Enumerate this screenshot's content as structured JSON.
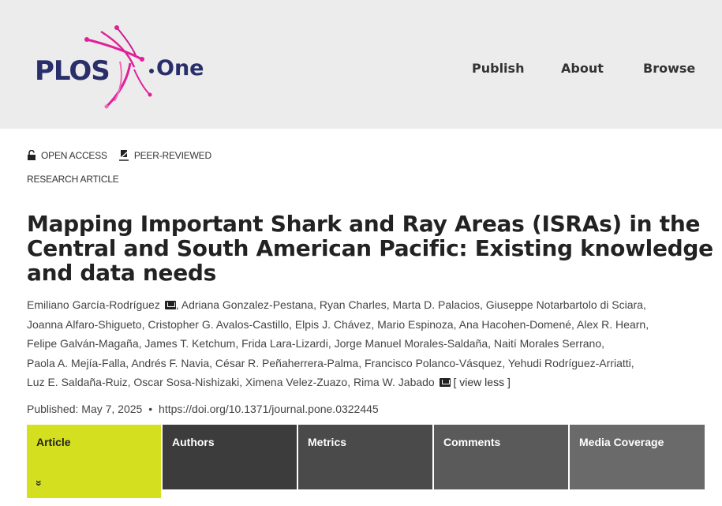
{
  "header": {
    "logo_brand": "PLOS",
    "logo_product": "One",
    "nav": [
      {
        "label": "Publish"
      },
      {
        "label": "About"
      },
      {
        "label": "Browse"
      }
    ]
  },
  "badges": {
    "open_access": "OPEN ACCESS",
    "peer_reviewed": "PEER-REVIEWED"
  },
  "article_type": "RESEARCH ARTICLE",
  "title": "Mapping Important Shark and Ray Areas (ISRAs) in the Central and South American Pacific: Existing knowledge and data needs",
  "authors": [
    "Emiliano García-Rodríguez",
    "Adriana Gonzalez-Pestana",
    "Ryan Charles",
    "Marta D. Palacios",
    "Giuseppe Notarbartolo di Sciara",
    "Joanna Alfaro-Shigueto",
    "Cristopher G. Avalos-Castillo",
    "Elpis J. Chávez",
    "Mario Espinoza",
    "Ana Hacohen-Domené",
    "Alex R. Hearn",
    "Felipe Galván-Magaña",
    "James T. Ketchum",
    "Frida Lara-Lizardi",
    "Jorge Manuel Morales-Saldaña",
    "Naití Morales Serrano",
    "Paola A. Mejía-Falla",
    "Andrés F. Navia",
    "César R. Peñaherrera-Palma",
    "Francisco Polanco-Vásquez",
    "Yehudi Rodríguez-Arriatti",
    "Luz E. Saldaña-Ruiz",
    "Oscar Sosa-Nishizaki",
    "Ximena Velez-Zuazo",
    "Rima W. Jabado"
  ],
  "view_less": "[ view less ]",
  "published": {
    "label": "Published:",
    "date": "May 7, 2025",
    "separator": "•",
    "doi": "https://doi.org/10.1371/journal.pone.0322445"
  },
  "tabs": [
    {
      "label": "Article"
    },
    {
      "label": "Authors"
    },
    {
      "label": "Metrics"
    },
    {
      "label": "Comments"
    },
    {
      "label": "Media Coverage"
    }
  ],
  "tab_chevron": "»",
  "colors": {
    "header_bg": "#ececec",
    "brand_navy": "#2a2f6b",
    "brand_magenta": "#e0209a",
    "active_tab": "#d4e01f"
  },
  "icons": [
    "lock-open-icon",
    "peer-review-icon",
    "mail-icon",
    "chevron-double-down-icon"
  ]
}
